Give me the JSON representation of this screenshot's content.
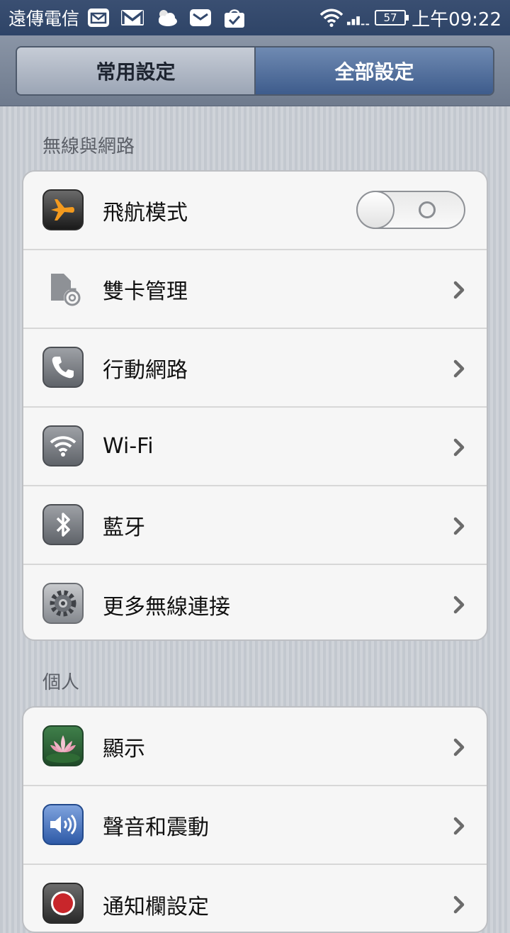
{
  "status_bar": {
    "carrier": "遠傳電信",
    "battery_level": "57",
    "time": "上午09:22",
    "icons": [
      "mail-icon",
      "gmail-icon",
      "weather-cloudy-icon",
      "email-icon",
      "shopping-bag-icon",
      "wifi-icon",
      "signal-icon",
      "battery-icon"
    ]
  },
  "tabs": {
    "common_label": "常用設定",
    "all_label": "全部設定",
    "selected": "全部設定"
  },
  "sections": [
    {
      "title": "無線與網路",
      "items": [
        {
          "label": "飛航模式",
          "icon": "airplane-icon",
          "control": "toggle",
          "toggle_state": "off"
        },
        {
          "label": "雙卡管理",
          "icon": "dual-sim-icon",
          "control": "chevron"
        },
        {
          "label": "行動網路",
          "icon": "phone-icon",
          "control": "chevron"
        },
        {
          "label": "Wi-Fi",
          "icon": "wifi-icon",
          "control": "chevron"
        },
        {
          "label": "藍牙",
          "icon": "bluetooth-icon",
          "control": "chevron"
        },
        {
          "label": "更多無線連接",
          "icon": "gear-icon",
          "control": "chevron"
        }
      ]
    },
    {
      "title": "個人",
      "items": [
        {
          "label": "顯示",
          "icon": "lotus-flower-icon",
          "control": "chevron"
        },
        {
          "label": "聲音和震動",
          "icon": "speaker-icon",
          "control": "chevron"
        },
        {
          "label": "通知欄設定",
          "icon": "record-icon",
          "control": "chevron"
        }
      ]
    }
  ],
  "colors": {
    "status_bar_bg": "#33496d",
    "tab_selected_bg": "#4a6898",
    "tab_unselected_bg": "#b3bac6",
    "airplane_orange": "#f39a1e"
  }
}
